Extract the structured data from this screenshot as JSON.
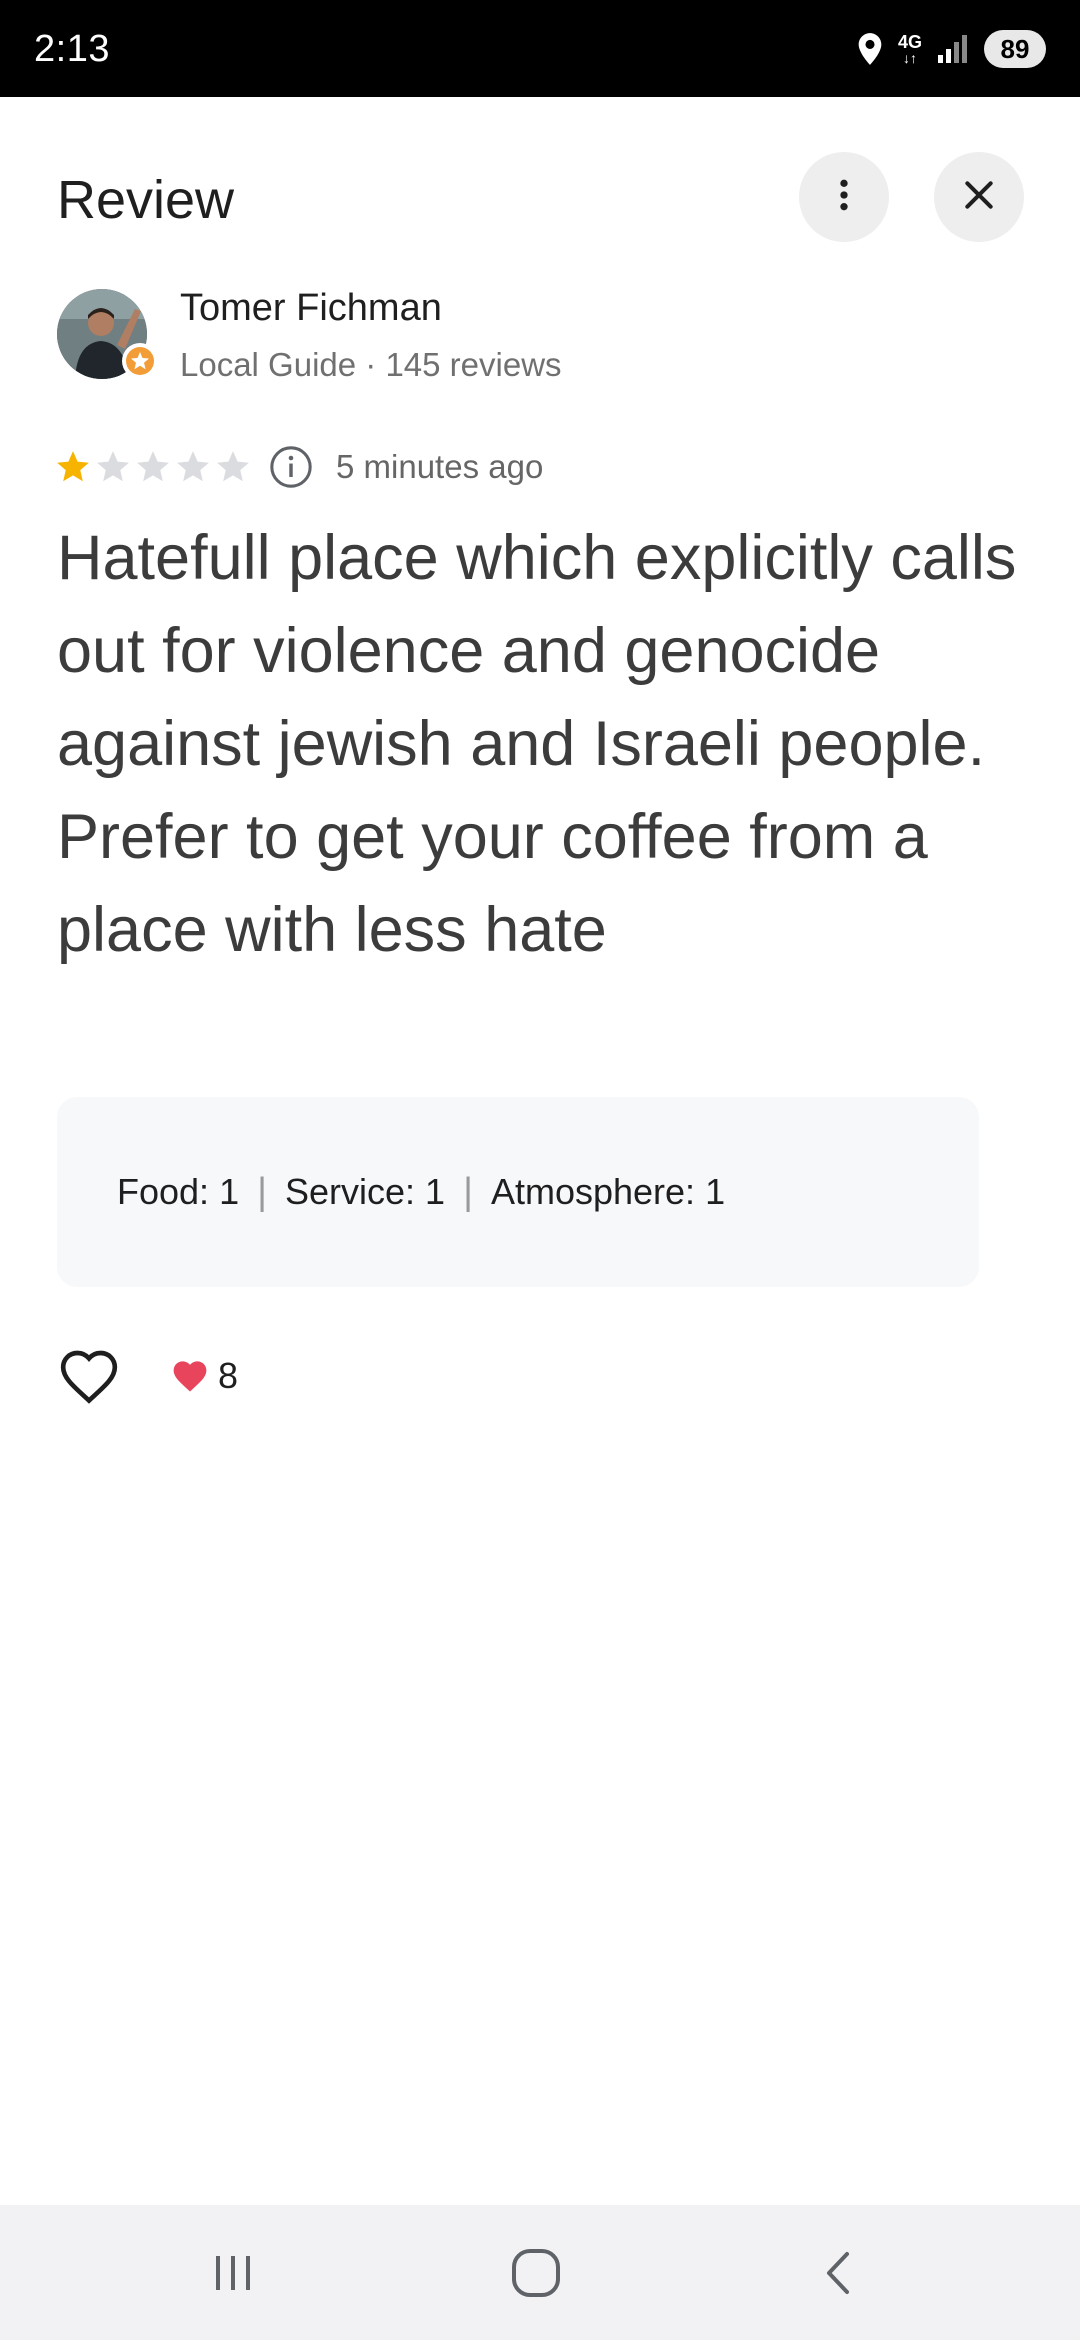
{
  "status_bar": {
    "time": "2:13",
    "network": "4G",
    "battery": "89"
  },
  "header": {
    "title": "Review"
  },
  "reviewer": {
    "name": "Tomer Fichman",
    "meta": "Local Guide · 145 reviews"
  },
  "review": {
    "rating": 1,
    "max_rating": 5,
    "time_ago": "5 minutes ago",
    "text": "Hatefull place which explicitly calls out for violence and genocide against jewish and Israeli people.\nPrefer to get your coffee from a place with less hate"
  },
  "attributes": [
    {
      "label": "Food:",
      "value": "1"
    },
    {
      "label": "Service:",
      "value": "1"
    },
    {
      "label": "Atmosphere:",
      "value": "1"
    }
  ],
  "reactions": {
    "like_count": "8"
  },
  "colors": {
    "star_filled": "#f6b400",
    "star_empty": "#dadce0",
    "heart": "#e8455d"
  },
  "icons": {
    "more": "more-vert-icon",
    "close": "close-icon",
    "info": "info-icon",
    "like": "heart-outline-icon",
    "like_count": "heart-filled-icon",
    "nav_recent": "recent-apps-icon",
    "nav_home": "home-icon",
    "nav_back": "back-icon"
  }
}
